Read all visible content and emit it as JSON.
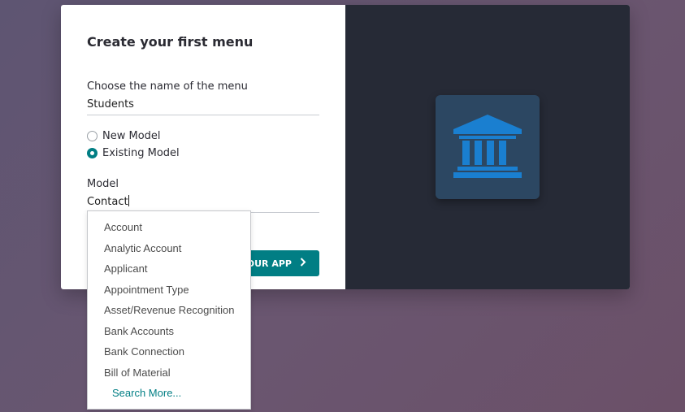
{
  "dialog": {
    "title": "Create your first menu",
    "menu_name_label": "Choose the name of the menu",
    "menu_name_value": "Students",
    "radio_new_label": "New Model",
    "radio_existing_label": "Existing Model",
    "model_label": "Model",
    "model_value": "Contact",
    "create_button_label": "OUR APP",
    "selected_option": "Existing Model"
  },
  "dropdown": {
    "items": [
      "Account",
      "Analytic Account",
      "Applicant",
      "Appointment Type",
      "Asset/Revenue Recognition",
      "Bank Accounts",
      "Bank Connection",
      "Bill of Material"
    ],
    "search_more": "Search More..."
  },
  "preview": {
    "icon": "bank-icon",
    "icon_bg_color": "#2c4762",
    "icon_fg_color": "#1a7fd0",
    "panel_color": "#262a36"
  },
  "colors": {
    "accent": "#017e84"
  }
}
